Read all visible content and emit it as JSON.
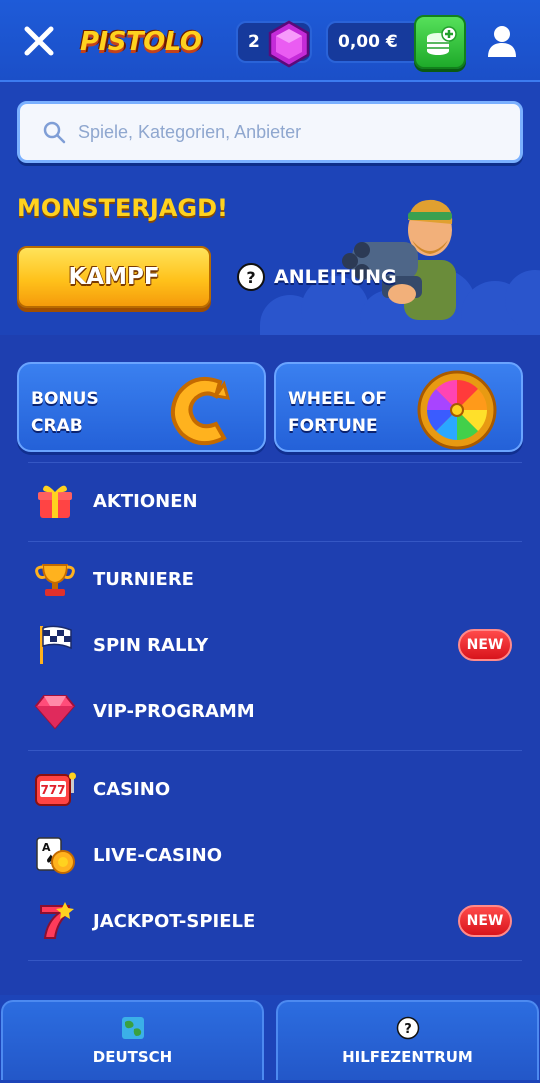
{
  "header": {
    "brand": "PISTOLO",
    "gems": "2",
    "balance": "0,00 €"
  },
  "search": {
    "placeholder": "Spiele, Kategorien, Anbieter"
  },
  "promo": {
    "title": "MONSTERJAGD!",
    "cta_label": "KAMPF",
    "guide_label": "ANLEITUNG"
  },
  "features": [
    {
      "label": "BONUS CRAB",
      "icon": "bonus-crab-icon"
    },
    {
      "label": "WHEEL OF FORTUNE",
      "icon": "wheel-of-fortune-icon"
    }
  ],
  "menu": [
    {
      "label": "AKTIONEN",
      "icon": "gift-icon"
    },
    {
      "label": "TURNIERE",
      "icon": "trophy-icon"
    },
    {
      "label": "SPIN RALLY",
      "icon": "checkered-flag-icon",
      "badge": "NEW"
    },
    {
      "label": "VIP-PROGRAMM",
      "icon": "diamond-icon"
    },
    {
      "label": "CASINO",
      "icon": "slot-machine-icon"
    },
    {
      "label": "LIVE-CASINO",
      "icon": "playing-cards-icon"
    },
    {
      "label": "JACKPOT-SPIELE",
      "icon": "lucky-seven-icon",
      "badge": "NEW"
    }
  ],
  "footer": {
    "language": "DEUTSCH",
    "help": "HILFEZENTRUM"
  },
  "colors": {
    "background": "#1d44b8",
    "accent_yellow": "#ffd21f",
    "badge_red": "#e0202a",
    "deposit_green": "#2cc236"
  }
}
